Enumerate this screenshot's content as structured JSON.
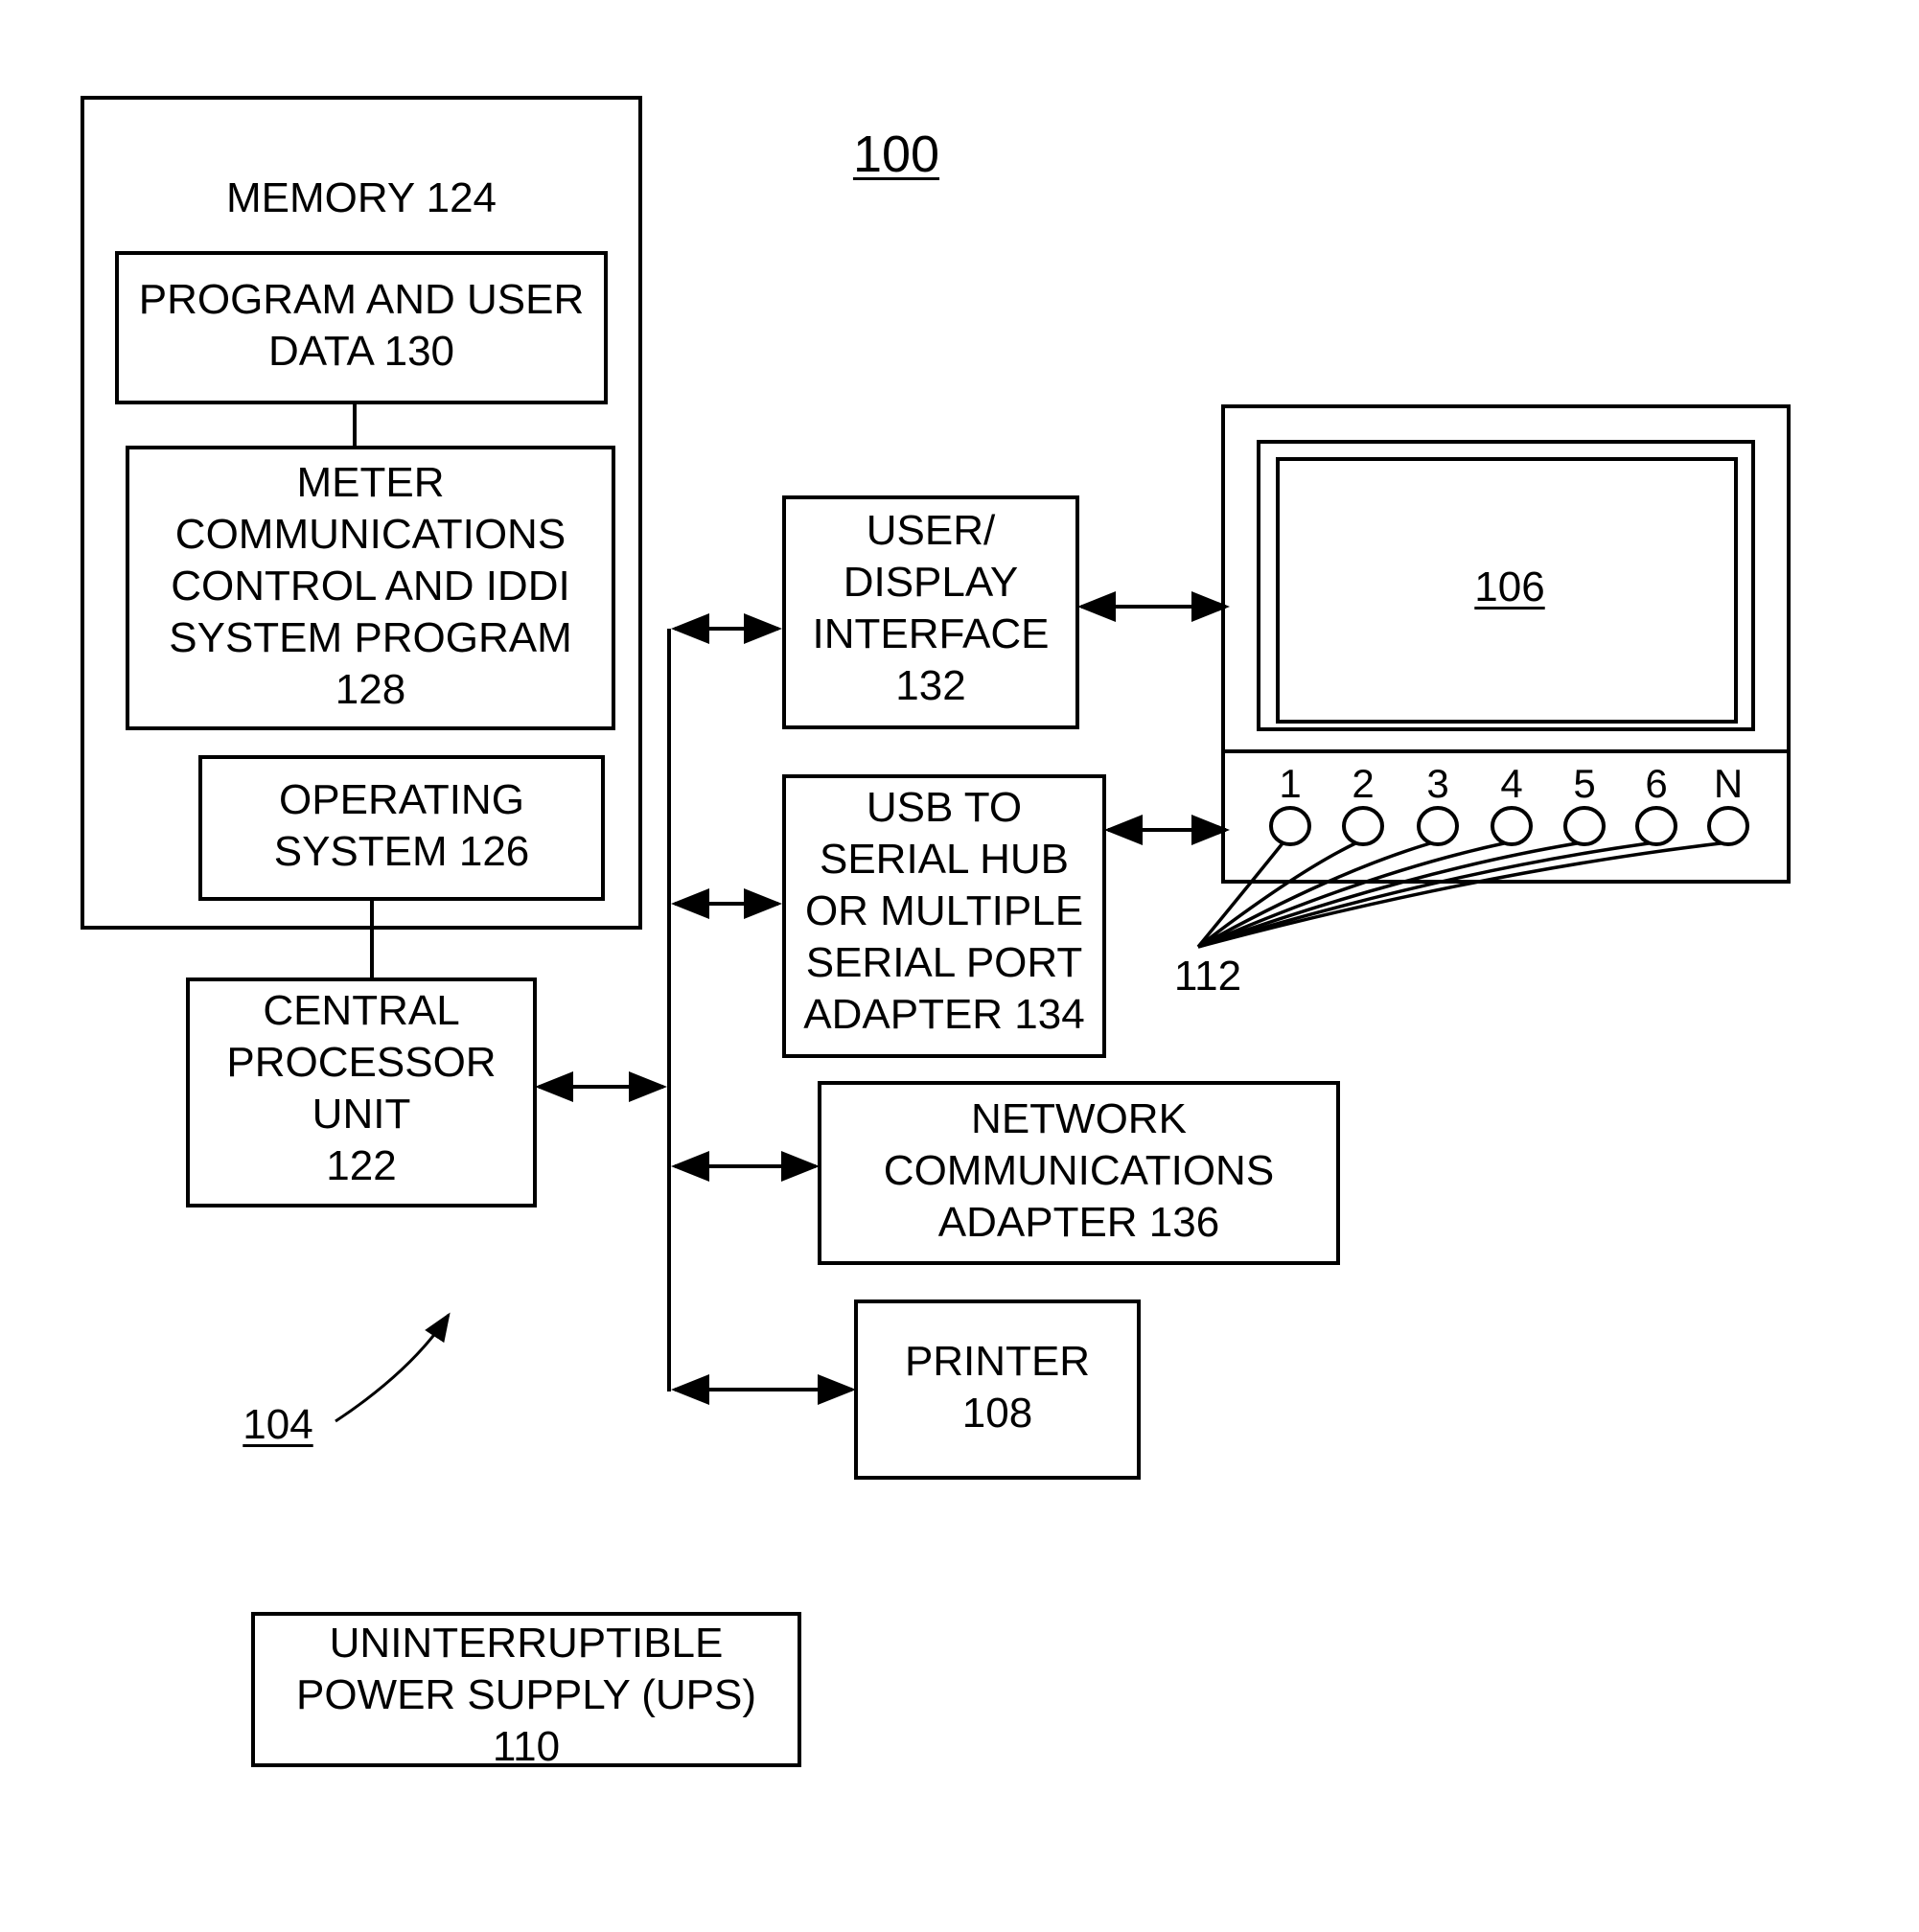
{
  "figure": {
    "reference": "100",
    "system_reference": "104",
    "ports_reference": "112"
  },
  "memory": {
    "title": "MEMORY 124",
    "program_data": "PROGRAM AND USER\nDATA 130",
    "meter_program": "METER\nCOMMUNICATIONS\nCONTROL AND IDDI\nSYSTEM PROGRAM\n128",
    "operating_system": "OPERATING\nSYSTEM 126"
  },
  "cpu": {
    "label": "CENTRAL\nPROCESSOR\nUNIT\n122"
  },
  "user_display_interface": {
    "label": "USER/\nDISPLAY\nINTERFACE\n132"
  },
  "usb_adapter": {
    "label": "USB TO\nSERIAL HUB\nOR MULTIPLE\nSERIAL PORT\nADAPTER 134"
  },
  "network_adapter": {
    "label": "NETWORK\nCOMMUNICATIONS\nADAPTER 136"
  },
  "printer": {
    "label": "PRINTER\n108"
  },
  "ups": {
    "label": "UNINTERRUPTIBLE\nPOWER SUPPLY (UPS)\n110"
  },
  "display": {
    "reference": "106"
  },
  "ports": [
    "1",
    "2",
    "3",
    "4",
    "5",
    "6",
    "N"
  ]
}
